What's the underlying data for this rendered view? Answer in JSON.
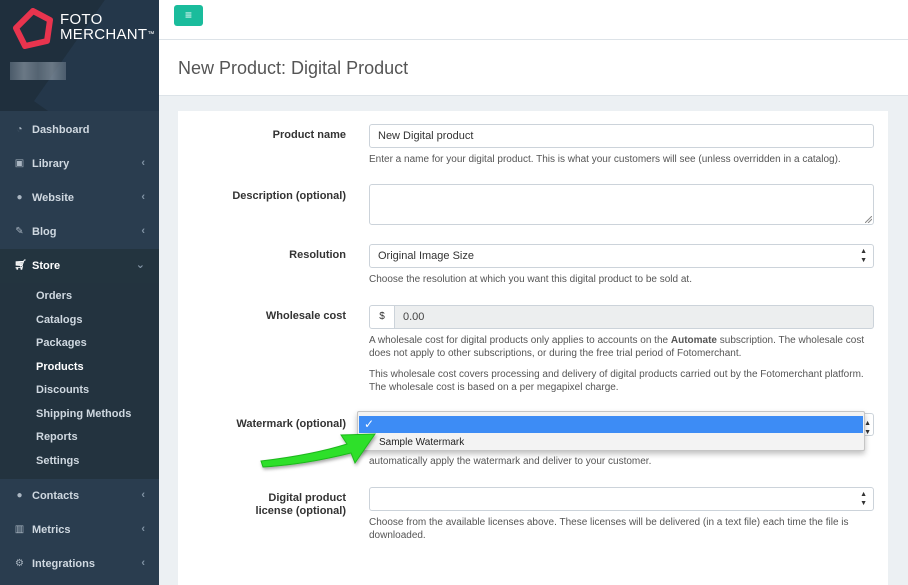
{
  "brand": {
    "line1": "FOTO",
    "line2": "MERCHANT",
    "tm": "™",
    "logo_color": "#e8344e"
  },
  "sidebar": {
    "items": [
      {
        "label": "Dashboard",
        "icon": "dashboard-icon",
        "chevron": ""
      },
      {
        "label": "Library",
        "icon": "image-icon",
        "chevron": "‹"
      },
      {
        "label": "Website",
        "icon": "globe-icon",
        "chevron": "‹"
      },
      {
        "label": "Blog",
        "icon": "edit-icon",
        "chevron": "‹"
      },
      {
        "label": "Store",
        "icon": "cart-icon",
        "chevron": "⌄"
      },
      {
        "label": "Contacts",
        "icon": "user-icon",
        "chevron": "‹"
      },
      {
        "label": "Metrics",
        "icon": "bar-chart-icon",
        "chevron": "‹"
      },
      {
        "label": "Integrations",
        "icon": "gear-icon",
        "chevron": "‹"
      }
    ],
    "store_submenu": [
      "Orders",
      "Catalogs",
      "Packages",
      "Products",
      "Discounts",
      "Shipping Methods",
      "Reports",
      "Settings"
    ]
  },
  "topbar": {
    "menu_icon": "≡",
    "accent": "#1abc9c"
  },
  "page": {
    "title": "New Product: Digital Product"
  },
  "form": {
    "product_name": {
      "label": "Product name",
      "value": "New Digital product",
      "help": "Enter a name for your digital product. This is what your customers will see (unless overridden in a catalog)."
    },
    "description": {
      "label": "Description (optional)",
      "value": ""
    },
    "resolution": {
      "label": "Resolution",
      "value": "Original Image Size",
      "help": "Choose the resolution at which you want this digital product to be sold at."
    },
    "wholesale_cost": {
      "label": "Wholesale cost",
      "currency": "$",
      "value": "0.00",
      "help1_pre": "A wholesale cost for digital products only applies to accounts on the ",
      "help1_bold": "Automate",
      "help1_post": " subscription. The wholesale cost does not apply to other subscriptions, or during the free trial period of Fotomerchant.",
      "help2": "This wholesale cost covers processing and delivery of digital products carried out by the Fotomerchant platform. The wholesale cost is based on a per megapixel charge."
    },
    "watermark": {
      "label": "Watermark (optional)",
      "selected_mark": "✓",
      "options": [
        "",
        "Sample Watermark"
      ],
      "help_visible": "automatically apply the watermark and deliver to your customer.",
      "highlight_color": "#3d8cf5"
    },
    "license": {
      "label_line1": "Digital product",
      "label_line2": "license (optional)",
      "value": "",
      "help": "Choose from the available licenses above. These licenses will be delivered (in a text file) each time the file is downloaded."
    }
  },
  "annotation": {
    "arrow_color": "#2ee02a"
  }
}
